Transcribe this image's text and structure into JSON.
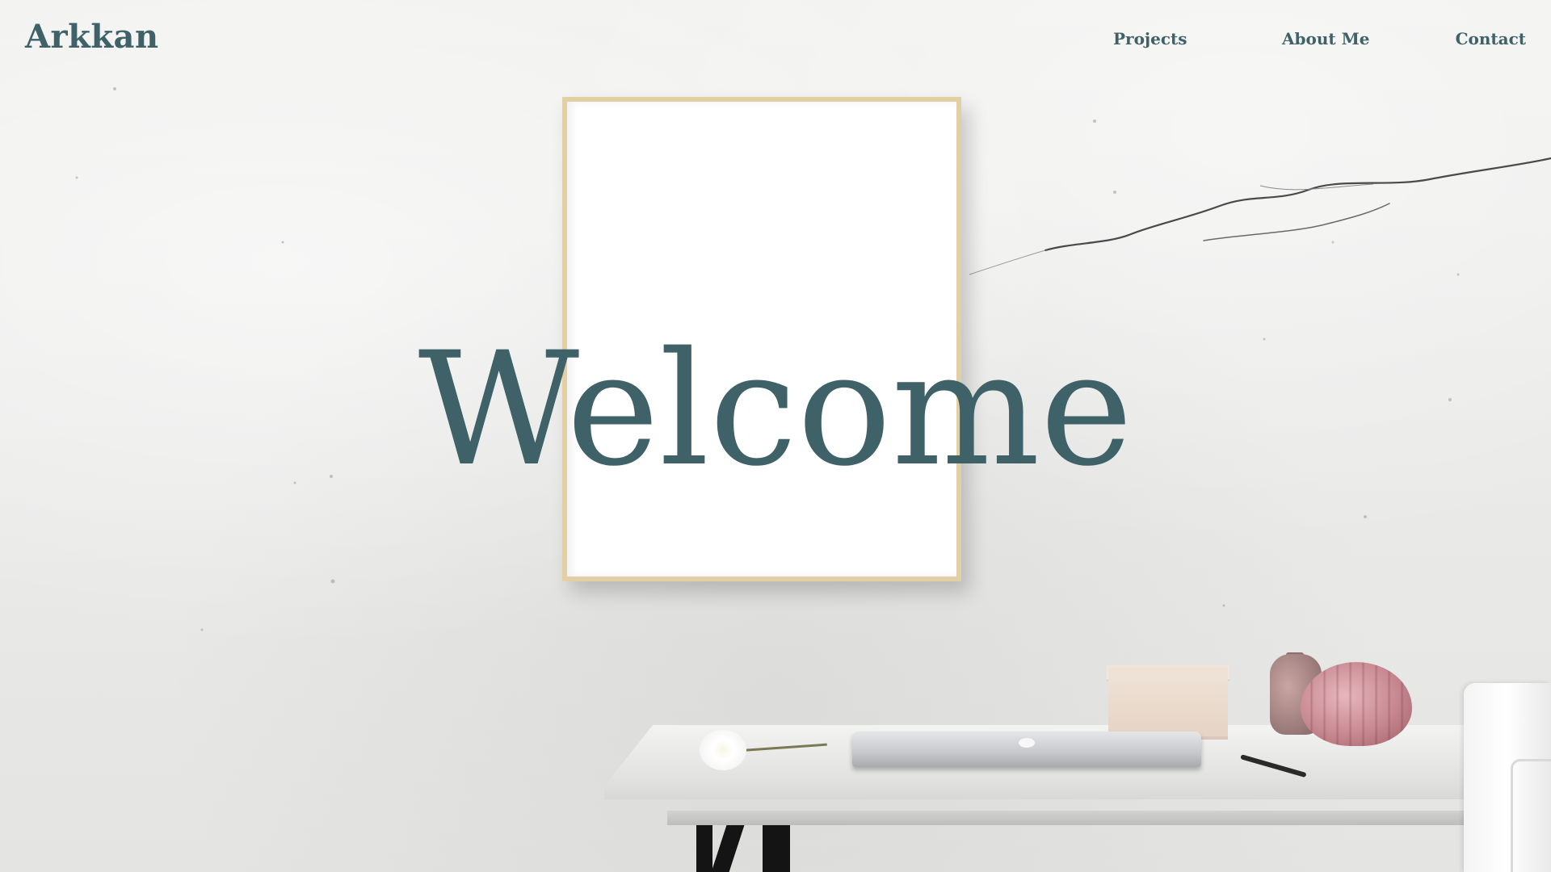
{
  "header": {
    "brand": "Arkkan",
    "nav": [
      {
        "label": "Projects"
      },
      {
        "label": "About Me"
      },
      {
        "label": "Contact"
      }
    ]
  },
  "hero": {
    "title": "Welcome"
  },
  "colors": {
    "accent": "#3f6168",
    "wall": "#ebebea",
    "frame": "#e3cfa4"
  }
}
